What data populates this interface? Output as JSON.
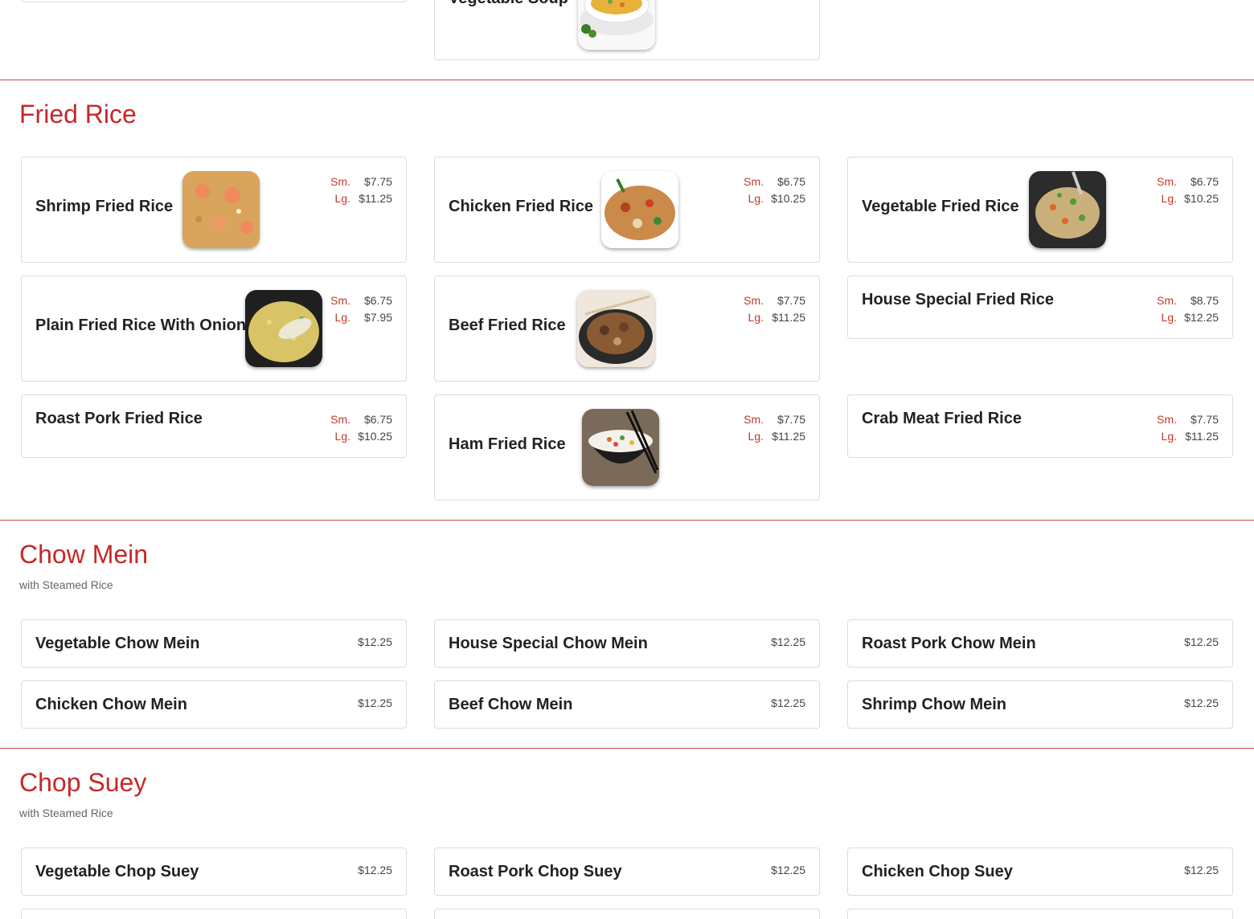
{
  "top_row": {
    "soup_item": "Vegetable Soup"
  },
  "fried_rice": {
    "title": "Fried Rice",
    "items": [
      {
        "name": "Shrimp Fried Rice",
        "sm": "$7.75",
        "lg": "$11.25"
      },
      {
        "name": "Chicken Fried Rice",
        "sm": "$6.75",
        "lg": "$10.25"
      },
      {
        "name": "Vegetable Fried Rice",
        "sm": "$6.75",
        "lg": "$10.25"
      },
      {
        "name": "Plain Fried Rice With Onion",
        "sm": "$6.75",
        "lg": "$7.95"
      },
      {
        "name": "Beef Fried Rice",
        "sm": "$7.75",
        "lg": "$11.25"
      },
      {
        "name": "House Special Fried Rice",
        "sm": "$8.75",
        "lg": "$12.25"
      },
      {
        "name": "Roast Pork Fried Rice",
        "sm": "$6.75",
        "lg": "$10.25"
      },
      {
        "name": "Ham Fried Rice",
        "sm": "$7.75",
        "lg": "$11.25"
      },
      {
        "name": "Crab Meat Fried Rice",
        "sm": "$7.75",
        "lg": "$11.25"
      }
    ]
  },
  "price_labels": {
    "sm": "Sm.",
    "lg": "Lg."
  },
  "chow_mein": {
    "title": "Chow Mein",
    "subtitle": "with Steamed Rice",
    "items": [
      {
        "name": "Vegetable Chow Mein",
        "price": "$12.25"
      },
      {
        "name": "House Special Chow Mein",
        "price": "$12.25"
      },
      {
        "name": "Roast Pork Chow Mein",
        "price": "$12.25"
      },
      {
        "name": "Chicken Chow Mein",
        "price": "$12.25"
      },
      {
        "name": "Beef Chow Mein",
        "price": "$12.25"
      },
      {
        "name": "Shrimp Chow Mein",
        "price": "$12.25"
      }
    ]
  },
  "chop_suey": {
    "title": "Chop Suey",
    "subtitle": "with Steamed Rice",
    "items": [
      {
        "name": "Vegetable Chop Suey",
        "price": "$12.25"
      },
      {
        "name": "Roast Pork Chop Suey",
        "price": "$12.25"
      },
      {
        "name": "Chicken Chop Suey",
        "price": "$12.25"
      }
    ]
  },
  "colors": {
    "accent": "#c62828",
    "divider": "#b52b2b",
    "card_border": "#dcdcdc"
  }
}
